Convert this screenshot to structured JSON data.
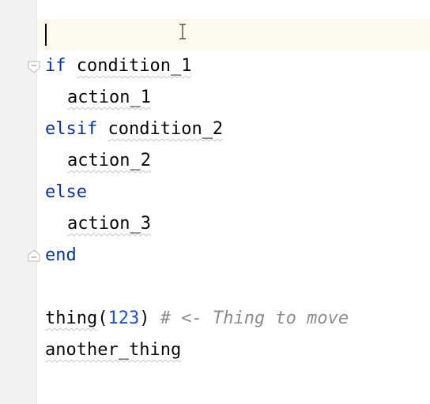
{
  "editor": {
    "lines": [
      {
        "keyword": "if",
        "text": "condition_1"
      },
      {
        "text": "action_1"
      },
      {
        "keyword": "elsif",
        "text": "condition_2"
      },
      {
        "text": "action_2"
      },
      {
        "keyword": "else"
      },
      {
        "text": "action_3"
      },
      {
        "keyword": "end"
      },
      {
        "call": "thing",
        "open": "(",
        "number": "123",
        "close": ")",
        "comment": "# <- Thing to move"
      },
      {
        "text": "another_thing"
      }
    ],
    "icons": {
      "fold_start": "fold-start-icon",
      "fold_end": "fold-end-icon",
      "cursor": "text-cursor-icon"
    },
    "colors": {
      "keyword": "#0033b3",
      "number": "#1750eb",
      "comment": "#8c8c8c",
      "current_line": "#fcfaed",
      "gutter": "#f2f2f2"
    }
  }
}
